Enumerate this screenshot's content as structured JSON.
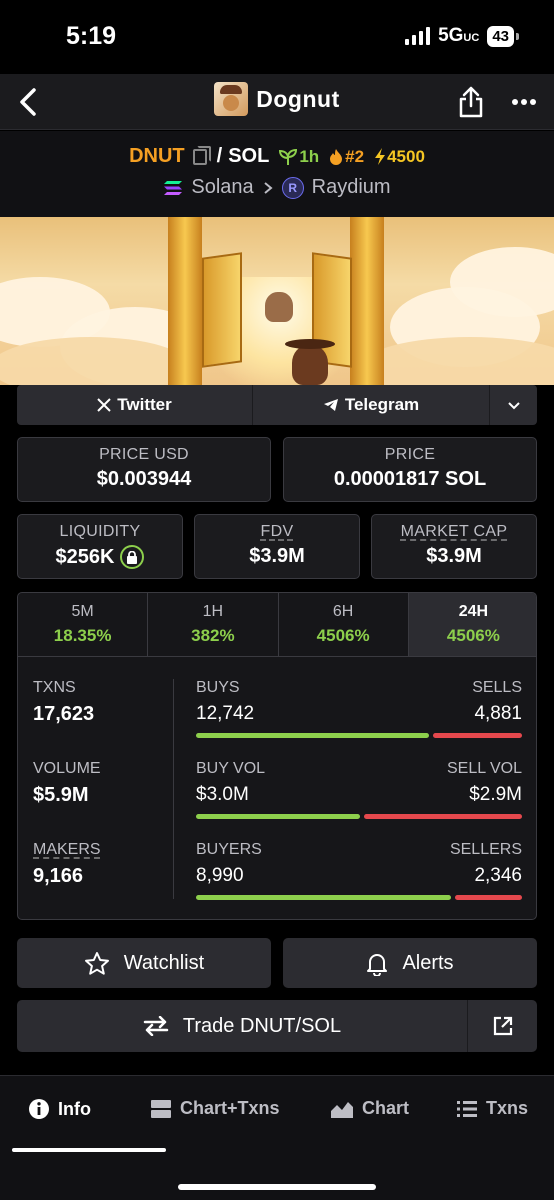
{
  "status": {
    "time": "5:19",
    "network": "5G",
    "network_sup": "UC",
    "battery": "43"
  },
  "header": {
    "title": "Dognut"
  },
  "pair": {
    "base": "DNUT",
    "separator": "/",
    "quote": "SOL",
    "age": "1h",
    "rank": "#2",
    "boosts": "4500",
    "chain": "Solana",
    "dex": "Raydium",
    "chain_color": "#9945FF",
    "dex_color": "#6c6cf0"
  },
  "socials": {
    "twitter": "Twitter",
    "telegram": "Telegram"
  },
  "price": {
    "usd_label": "PRICE USD",
    "usd_value": "$0.003944",
    "native_label": "PRICE",
    "native_value": "0.00001817 SOL"
  },
  "metrics": {
    "liquidity_label": "LIQUIDITY",
    "liquidity_value": "$256K",
    "fdv_label": "FDV",
    "fdv_value": "$3.9M",
    "mcap_label": "MARKET CAP",
    "mcap_value": "$3.9M"
  },
  "timeframes": [
    {
      "label": "5M",
      "change": "18.35%"
    },
    {
      "label": "1H",
      "change": "382%"
    },
    {
      "label": "6H",
      "change": "4506%"
    },
    {
      "label": "24H",
      "change": "4506%"
    }
  ],
  "selected_timeframe": "24H",
  "stats": {
    "txns_label": "TXNS",
    "txns_value": "17,623",
    "volume_label": "VOLUME",
    "volume_value": "$5.9M",
    "makers_label": "MAKERS",
    "makers_value": "9,166",
    "buys_label": "BUYS",
    "buys_value": "12,742",
    "buys_share": 0.723,
    "sells_label": "SELLS",
    "sells_value": "4,881",
    "buyvol_label": "BUY VOL",
    "buyvol_value": "$3.0M",
    "buyvol_share": 0.508,
    "sellvol_label": "SELL VOL",
    "sellvol_value": "$2.9M",
    "buyers_label": "BUYERS",
    "buyers_value": "8,990",
    "buyers_share": 0.793,
    "sellers_label": "SELLERS",
    "sellers_value": "2,346"
  },
  "actions": {
    "watchlist": "Watchlist",
    "alerts": "Alerts",
    "trade": "Trade DNUT/SOL"
  },
  "nav": {
    "info": "Info",
    "chart_txns": "Chart+Txns",
    "chart": "Chart",
    "txns": "Txns"
  },
  "colors": {
    "up": "#8dcf4c",
    "down": "#e5484d",
    "accent": "#f5a023"
  }
}
